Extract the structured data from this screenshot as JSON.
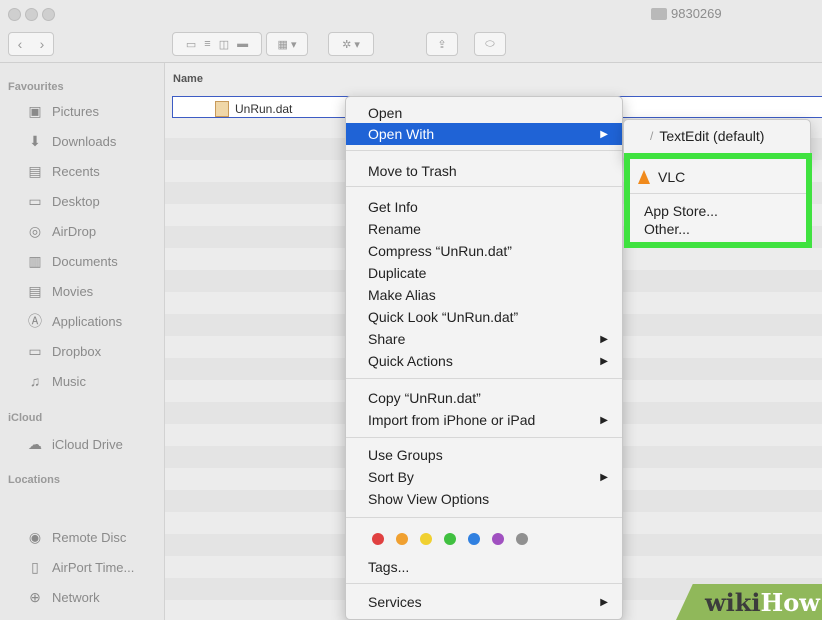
{
  "window": {
    "title": "9830269"
  },
  "sidebar": {
    "favourites_label": "Favourites",
    "items": [
      {
        "label": "Pictures",
        "icon": "pictures-icon"
      },
      {
        "label": "Downloads",
        "icon": "downloads-icon"
      },
      {
        "label": "Recents",
        "icon": "recents-icon"
      },
      {
        "label": "Desktop",
        "icon": "desktop-icon"
      },
      {
        "label": "AirDrop",
        "icon": "airdrop-icon"
      },
      {
        "label": "Documents",
        "icon": "documents-icon"
      },
      {
        "label": "Movies",
        "icon": "movies-icon"
      },
      {
        "label": "Applications",
        "icon": "applications-icon"
      },
      {
        "label": "Dropbox",
        "icon": "dropbox-icon"
      },
      {
        "label": "Music",
        "icon": "music-icon"
      }
    ],
    "icloud_label": "iCloud",
    "icloud_items": [
      {
        "label": "iCloud Drive",
        "icon": "cloud-icon"
      }
    ],
    "locations_label": "Locations",
    "location_items": [
      {
        "label": "Remote Disc",
        "icon": "disc-icon"
      },
      {
        "label": "AirPort Time...",
        "icon": "airport-icon"
      },
      {
        "label": "Network",
        "icon": "network-icon"
      }
    ]
  },
  "main": {
    "column_name": "Name",
    "file": {
      "name": "UnRun.dat"
    }
  },
  "context_menu": {
    "open": "Open",
    "open_with": "Open With",
    "move_to_trash": "Move to Trash",
    "get_info": "Get Info",
    "rename": "Rename",
    "compress": "Compress “UnRun.dat”",
    "duplicate": "Duplicate",
    "make_alias": "Make Alias",
    "quick_look": "Quick Look “UnRun.dat”",
    "share": "Share",
    "quick_actions": "Quick Actions",
    "copy": "Copy “UnRun.dat”",
    "import": "Import from iPhone or iPad",
    "use_groups": "Use Groups",
    "sort_by": "Sort By",
    "show_view_options": "Show View Options",
    "tags": "Tags...",
    "services": "Services",
    "tag_colors": [
      "#e04040",
      "#f0a030",
      "#f0d030",
      "#40c040",
      "#3080e0",
      "#a050c0",
      "#909090"
    ]
  },
  "submenu": {
    "textedit": "TextEdit (default)",
    "vlc": "VLC",
    "app_store": "App Store...",
    "other": "Other..."
  },
  "watermark": {
    "part1": "wiki",
    "part2": "How"
  },
  "colors": {
    "highlight": "#1f63d6",
    "callout": "#3fe23f"
  }
}
